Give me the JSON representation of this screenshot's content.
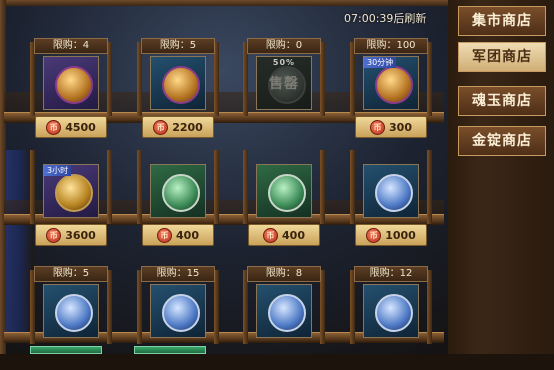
{
  "timer_text": "07:00:39后刷新",
  "nav": [
    {
      "label": "集市商店",
      "active": false
    },
    {
      "label": "军团商店",
      "active": true
    },
    {
      "label": "魂玉商店",
      "active": false
    },
    {
      "label": "金锭商店",
      "active": false
    }
  ],
  "items": [
    {
      "limit": "限购：4",
      "price": "4500",
      "tile": "purple",
      "emblem": "gold",
      "icon": "purple-gold-pouch-icon"
    },
    {
      "limit": "限购：5",
      "price": "2200",
      "tile": "blue",
      "emblem": "gold",
      "icon": "purple-gold-pouch-icon"
    },
    {
      "limit": "限购：0",
      "price": "",
      "tile": "gray",
      "emblem": "dim",
      "icon": "dimmed-item-icon",
      "sold_text": "售罄",
      "sold_pct": "50%"
    },
    {
      "limit": "限购：100",
      "price": "300",
      "tile": "blue",
      "emblem": "gold",
      "icon": "hourglass-token-icon",
      "tag": "30分钟"
    },
    {
      "limit": "",
      "price": "3600",
      "tile": "purple",
      "emblem": "gem",
      "icon": "hourglass-token-icon",
      "tag": "3小时"
    },
    {
      "limit": "",
      "price": "400",
      "tile": "green",
      "emblem": "green",
      "icon": "green-jade-icon"
    },
    {
      "limit": "",
      "price": "400",
      "tile": "green",
      "emblem": "green",
      "icon": "green-jade-icon"
    },
    {
      "limit": "",
      "price": "1000",
      "tile": "blue",
      "emblem": "blue",
      "icon": "blue-jade-icon"
    },
    {
      "limit": "限购：5",
      "price": "",
      "tile": "blue",
      "emblem": "blue",
      "icon": "blue-jade-icon"
    },
    {
      "limit": "限购：15",
      "price": "",
      "tile": "blue",
      "emblem": "blue",
      "icon": "blue-jade-icon"
    },
    {
      "limit": "限购：8",
      "price": "",
      "tile": "blue",
      "emblem": "blue",
      "icon": "blue-jade-icon"
    },
    {
      "limit": "限购：12",
      "price": "",
      "tile": "blue",
      "emblem": "blue",
      "icon": "blue-jade-icon"
    }
  ]
}
